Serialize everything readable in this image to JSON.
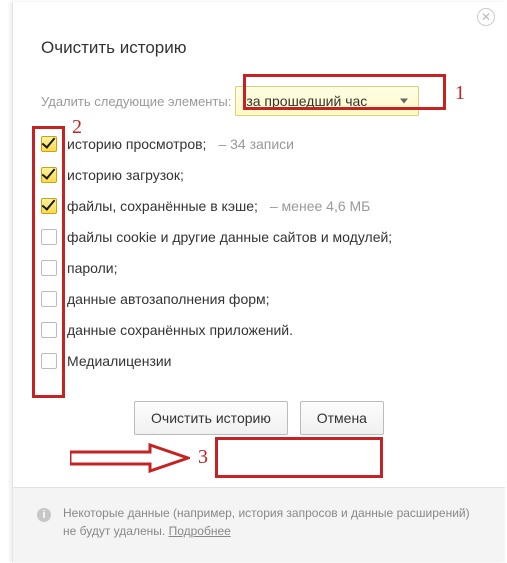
{
  "dialog": {
    "title": "Очистить историю",
    "close_icon": "✕",
    "timerange_label": "Удалить следующие элементы:",
    "timerange_selected": "за прошедший час",
    "options": [
      {
        "label": "историю просмотров;",
        "hint": "–  34 записи",
        "checked": true
      },
      {
        "label": "историю загрузок;",
        "hint": "",
        "checked": true
      },
      {
        "label": "файлы, сохранённые в кэше;",
        "hint": "–  менее 4,6 МБ",
        "checked": true
      },
      {
        "label": "файлы cookie и другие данные сайтов и модулей;",
        "hint": "",
        "checked": false
      },
      {
        "label": "пароли;",
        "hint": "",
        "checked": false
      },
      {
        "label": "данные автозаполнения форм;",
        "hint": "",
        "checked": false
      },
      {
        "label": "данные сохранённых приложений.",
        "hint": "",
        "checked": false
      },
      {
        "label": "Медиалицензии",
        "hint": "",
        "checked": false
      }
    ],
    "buttons": {
      "clear": "Очистить историю",
      "cancel": "Отмена"
    },
    "footer_text": "Некоторые данные (например, история запросов и данные расширений) не будут удалены. ",
    "footer_link": "Подробнее"
  },
  "annotations": {
    "n1": "1",
    "n2": "2",
    "n3": "3"
  }
}
